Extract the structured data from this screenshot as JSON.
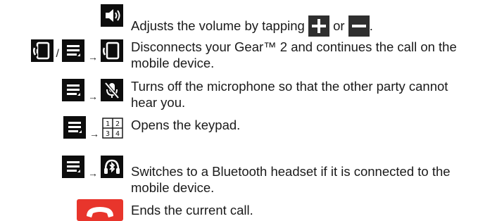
{
  "rows": [
    {
      "text_pre": "Adjusts the volume by tapping",
      "text_mid": "or",
      "text_post": ".",
      "icons": [
        "speaker-icon"
      ]
    },
    {
      "separator": "/",
      "arrow": "→",
      "text": "Disconnects your Gear™ 2 and continues the call on the mobile device.",
      "icons": [
        "phone-icon",
        "menu-icon",
        "phone-icon"
      ]
    },
    {
      "arrow": "→",
      "text": "Turns off the microphone so that the other party cannot hear you.",
      "icons": [
        "menu-icon",
        "mute-microphone-icon"
      ]
    },
    {
      "arrow": "→",
      "text": "Opens the keypad.",
      "icons": [
        "menu-icon",
        "keypad-icon"
      ]
    },
    {
      "arrow": "→",
      "text": "Switches to a Bluetooth headset if it is connected to the mobile device.",
      "icons": [
        "menu-icon",
        "bluetooth-headset-icon"
      ]
    },
    {
      "text": "Ends the current call.",
      "icons": [
        "end-call-icon"
      ]
    }
  ],
  "keypad_digits": [
    "1",
    "2",
    "3",
    "4"
  ],
  "colors": {
    "icon_bg": "#0d0d0d",
    "plus_minus_bg": "#2f2f2f",
    "end_call": "#e8352c",
    "text": "#1a1a1a"
  }
}
